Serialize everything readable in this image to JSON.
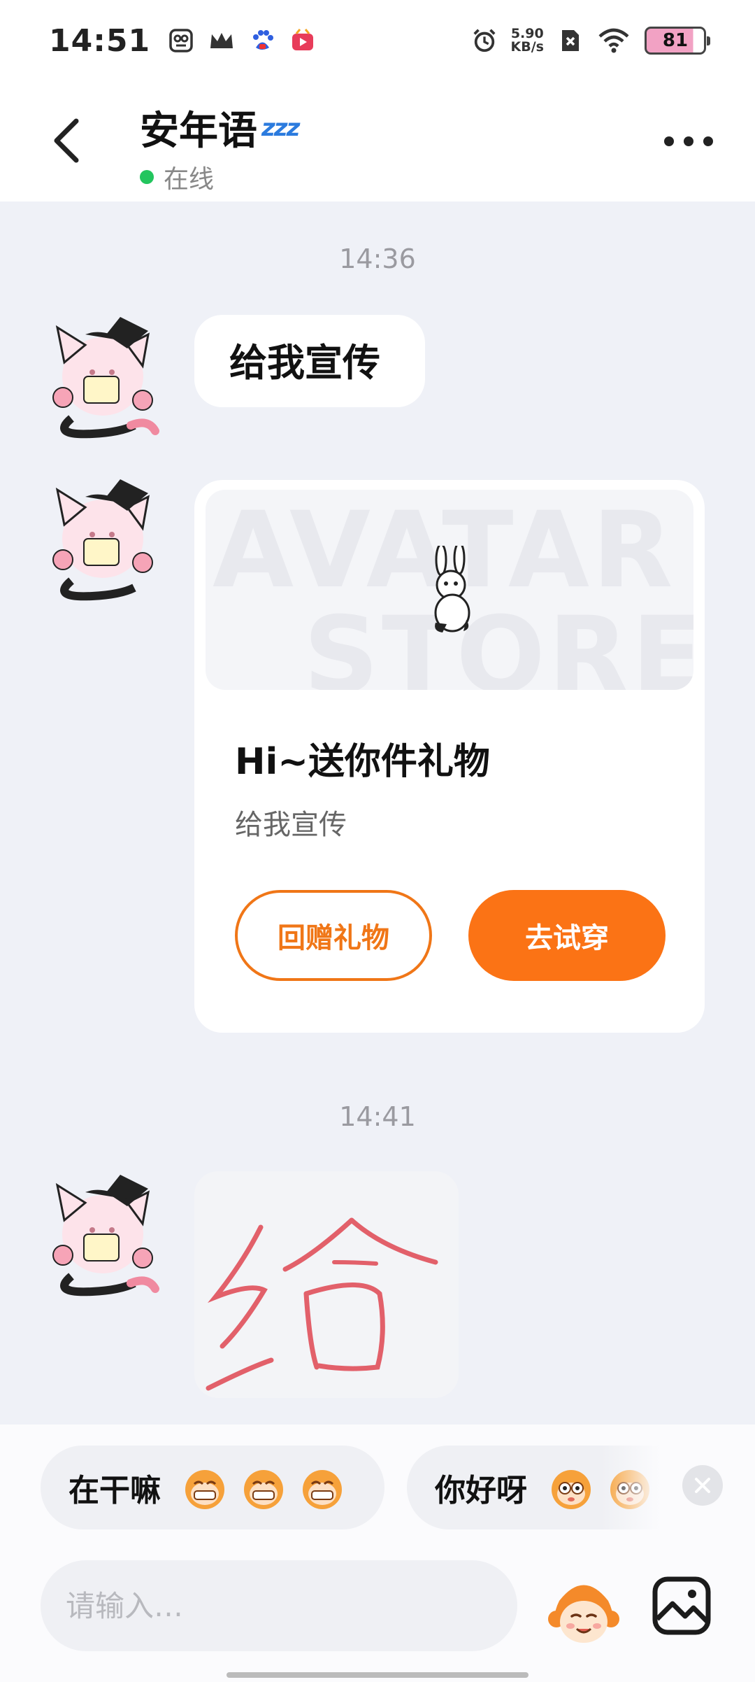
{
  "status_bar": {
    "time": "14:51",
    "net_speed_value": "5.90",
    "net_speed_unit": "KB/s",
    "battery": "81",
    "left_icons": [
      "scan-app-icon",
      "crown-icon",
      "baidu-paw-icon",
      "video-app-icon"
    ],
    "right_icons": [
      "alarm-icon",
      "sim-off-icon",
      "wifi-icon"
    ]
  },
  "header": {
    "contact_name": "安年语",
    "sleep_badge": "zzz",
    "status_text": "在线",
    "status_color": "#23c55e"
  },
  "chat": {
    "messages": [
      {
        "time": "14:36",
        "text": "给我宣传"
      },
      {
        "gift_card": {
          "banner_watermark_line1": "AVATAR",
          "banner_watermark_line2": "STORE",
          "title": "Hi~送你件礼物",
          "subtitle": "给我宣传",
          "return_gift_label": "回赠礼物",
          "try_on_label": "去试穿"
        }
      },
      {
        "time": "14:41",
        "handwriting_text": "给"
      }
    ]
  },
  "quick_replies": [
    {
      "text": "在干嘛",
      "emoji": "grin-monkey-icon",
      "emoji_count": 3
    },
    {
      "text": "你好呀",
      "emoji": "wide-eye-monkey-icon",
      "emoji_count": 2
    }
  ],
  "input": {
    "placeholder": "请输入…"
  },
  "colors": {
    "accent": "#fb7315",
    "chat_bg": "#eff1f7"
  }
}
